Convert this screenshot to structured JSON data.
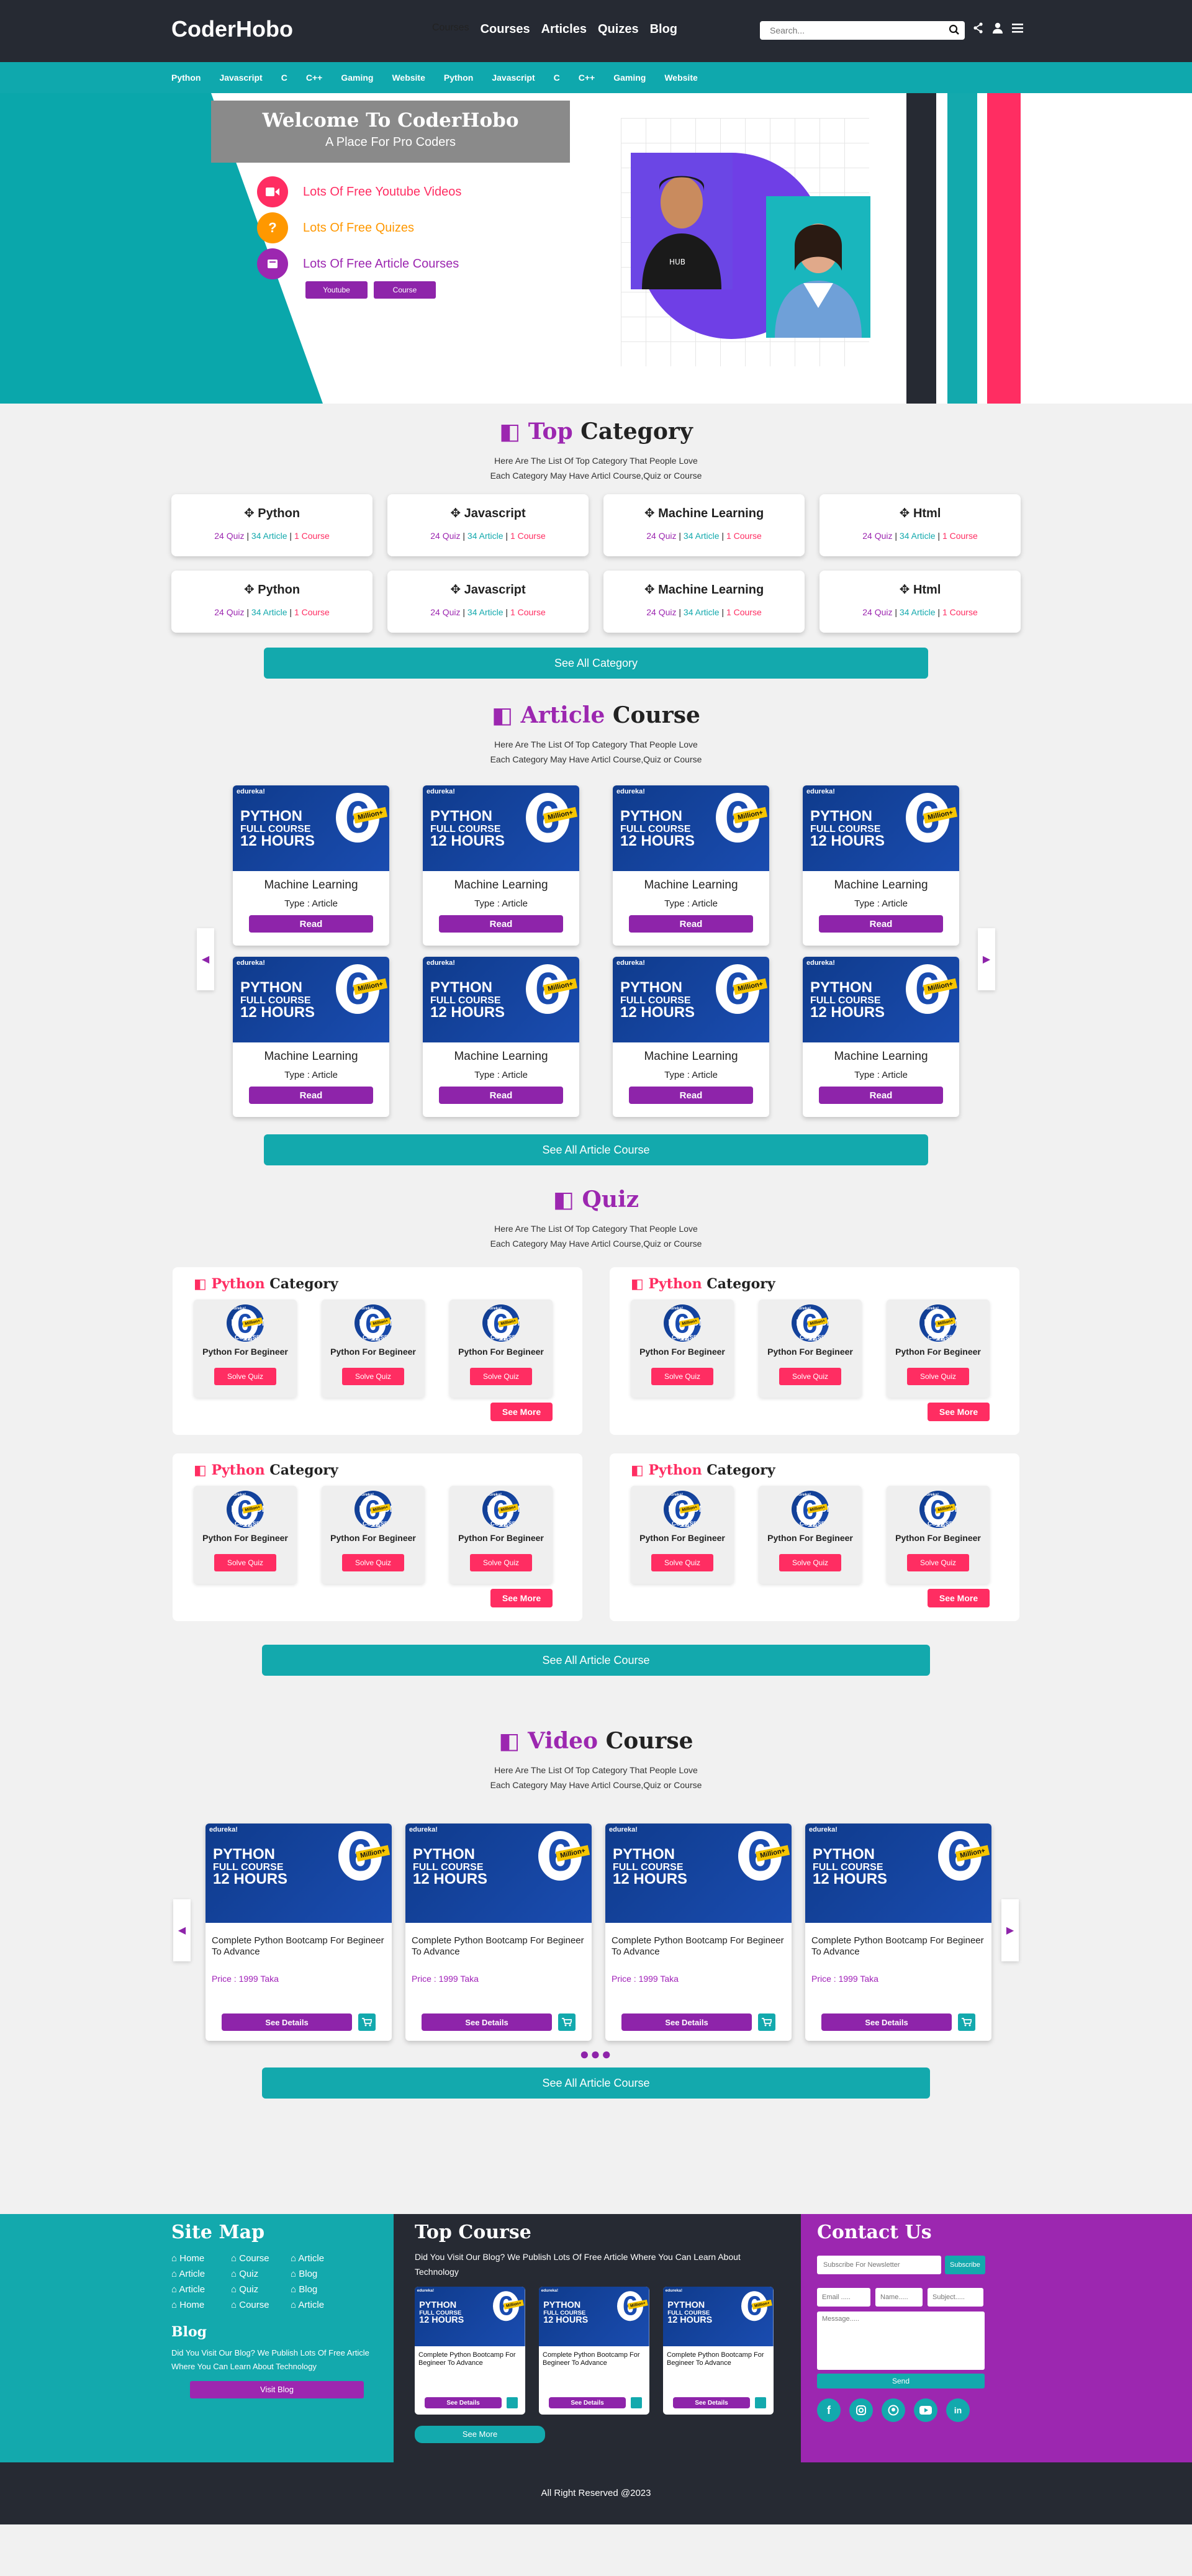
{
  "header": {
    "logo": "CoderHobo",
    "nav": [
      "Courses",
      "Articles",
      "Quizes",
      "Blog"
    ],
    "search_placeholder": "Search..."
  },
  "subnav": [
    "Python",
    "Javascript",
    "C",
    "C++",
    "Gaming",
    "Website",
    "Python",
    "Javascript",
    "C",
    "C++",
    "Gaming",
    "Website"
  ],
  "hero": {
    "title": "Welcome To CoderHobo",
    "subtitle": "A Place For Pro Coders",
    "features": [
      {
        "text": "Lots Of Free Youtube Videos",
        "color": "#ff2d62"
      },
      {
        "text": "Lots Of Free Quizes",
        "color": "#ff9800"
      },
      {
        "text": "Lots Of Free Article Courses",
        "color": "#9c27b0"
      }
    ],
    "btn_youtube": "Youtube",
    "btn_course": "Course"
  },
  "top_category": {
    "title_a": "Top",
    "title_b": "Category",
    "subtitle": "Here Are The List Of Top Category That People Love Each Category May Have Articl Course,Quiz or Course",
    "quiz": "24 Quiz",
    "article": "34 Article",
    "course": "1 Course",
    "sep": "|",
    "items": [
      "Python",
      "Javascript",
      "Machine Learning",
      "Html",
      "Python",
      "Javascript",
      "Machine Learning",
      "Html"
    ],
    "button": "See All Category"
  },
  "article_course": {
    "title_a": "Article",
    "title_b": "Course",
    "subtitle": "Here Are The List Of Top Category That People Love Each Category May Have Articl Course,Quiz or Course",
    "card_name": "Machine Learning",
    "card_type": "Type : Article",
    "read": "Read",
    "button": "See All Article Course"
  },
  "thumb": {
    "brand": "edureka!",
    "line1": "PYTHON",
    "line2": "FULL COURSE",
    "line3": "12 HOURS",
    "six": "6",
    "million": "Million+"
  },
  "quiz": {
    "title": "Quiz",
    "subtitle": "Here Are The List Of Top Category That People Love Each Category May Have Articl Course,Quiz or Course",
    "box_a": "Python",
    "box_b": "Category",
    "card_name": "Python For Begineer",
    "solve": "Solve Quiz",
    "see_more": "See More",
    "button": "See All Article Course"
  },
  "video": {
    "title_a": "Video",
    "title_b": "Course",
    "subtitle": "Here Are The List Of Top Category That People Love Each Category May Have Articl Course,Quiz or Course",
    "card_title": "Complete Python Bootcamp For Begineer To Advance",
    "price": "Price : 1999 Taka",
    "details": "See Details",
    "button": "See All Article Course"
  },
  "footer": {
    "sitemap_title": "Site Map",
    "sitemap": [
      "Home",
      "Course",
      "Article",
      "Article",
      "Quiz",
      "Blog",
      "Article",
      "Quiz",
      "Blog",
      "Home",
      "Course",
      "Article"
    ],
    "blog_title": "Blog",
    "blog_text": "Did You Visit Our Blog? We Publish Lots Of Free Article Where You Can Learn About Technology",
    "visit_blog": "Visit Blog",
    "top_course_title": "Top Course",
    "top_course_text": "Did You Visit Our Blog? We Publish Lots Of Free  Article Where You Can Learn  About Technology",
    "mini_title": "Complete Python Bootcamp For  Begineer To Advance",
    "mini_details": "See Details",
    "see_more": "See More",
    "contact_title": "Contact Us",
    "newsletter_placeholder": "Subscribe For Newsletter",
    "subscribe": "Subscribe",
    "email_ph": "Email .....",
    "name_ph": "Name.....",
    "subject_ph": "Subject.....",
    "message_ph": "Message.....",
    "send": "Send",
    "copyright": "All Right Reserved @2023"
  }
}
